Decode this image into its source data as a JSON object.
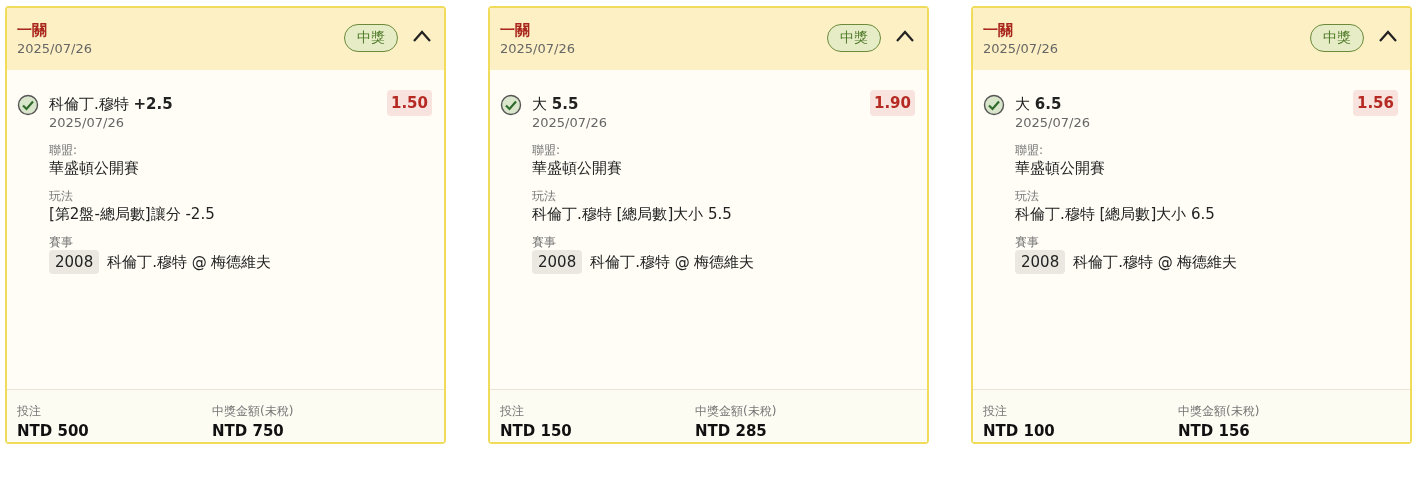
{
  "cards": [
    {
      "type": "一關",
      "date": "2025/07/26",
      "status": "中獎",
      "expanded": true,
      "selection": "科倫丁.穆特 **+2.5**",
      "selection_date": "2025/07/26",
      "odds": "1.50",
      "league_label": "聯盟:",
      "league": "華盛頓公開賽",
      "play_label": "玩法",
      "play": "[第2盤-總局數]讓分 -2.5",
      "event_label": "賽事",
      "event_code": "2008",
      "event": "科倫丁.穆特 @ 梅德維夫",
      "stake_label": "投注",
      "stake": "NTD 500",
      "payout_label": "中獎金額(未稅)",
      "payout": "NTD 750"
    },
    {
      "type": "一關",
      "date": "2025/07/26",
      "status": "中獎",
      "expanded": true,
      "selection": "大 **5.5**",
      "selection_date": "2025/07/26",
      "odds": "1.90",
      "league_label": "聯盟:",
      "league": "華盛頓公開賽",
      "play_label": "玩法",
      "play": "科倫丁.穆特 [總局數]大小 5.5",
      "event_label": "賽事",
      "event_code": "2008",
      "event": "科倫丁.穆特 @ 梅德維夫",
      "stake_label": "投注",
      "stake": "NTD 150",
      "payout_label": "中獎金額(未稅)",
      "payout": "NTD 285"
    },
    {
      "type": "一關",
      "date": "2025/07/26",
      "status": "中獎",
      "expanded": true,
      "selection": "大 **6.5**",
      "selection_date": "2025/07/26",
      "odds": "1.56",
      "league_label": "聯盟:",
      "league": "華盛頓公開賽",
      "play_label": "玩法",
      "play": "科倫丁.穆特 [總局數]大小 6.5",
      "event_label": "賽事",
      "event_code": "2008",
      "event": "科倫丁.穆特 @ 梅德維夫",
      "stake_label": "投注",
      "stake": "NTD 100",
      "payout_label": "中獎金額(未稅)",
      "payout": "NTD 156"
    }
  ]
}
